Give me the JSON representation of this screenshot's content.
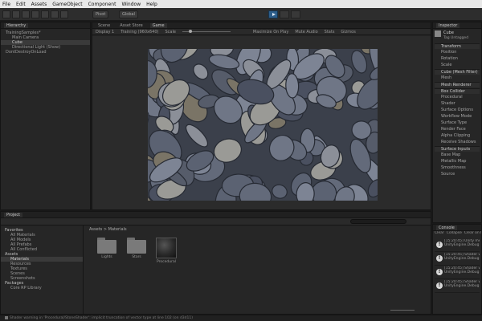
{
  "menu": [
    "File",
    "Edit",
    "Assets",
    "GameObject",
    "Component",
    "Window",
    "Help"
  ],
  "toolbar": {
    "pivot_label": "Pivot",
    "global_label": "Global"
  },
  "hierarchy": {
    "tab_label": "Hierarchy",
    "items": [
      {
        "label": "TrainingSamples*",
        "indent": 0,
        "selected": false
      },
      {
        "label": "Main Camera",
        "indent": 1,
        "selected": false
      },
      {
        "label": "Cube",
        "indent": 1,
        "selected": true
      },
      {
        "label": "Directional Light (Show)",
        "indent": 1,
        "selected": false
      },
      {
        "label": "DontDestroyOnLoad",
        "indent": 0,
        "selected": false
      }
    ]
  },
  "center": {
    "tabs": [
      "Scene",
      "Asset Store",
      "Game"
    ],
    "display_label": "Display 1",
    "aspect_label": "Training (960x640)",
    "scale_label": "Scale",
    "maximize_label": "Maximize On Play",
    "mute_label": "Mute Audio",
    "stats_label": "Stats",
    "gizmos_label": "Gizmos"
  },
  "inspector": {
    "tab_label": "Inspector",
    "object_name": "Cube",
    "tag_label": "Tag Untagged",
    "rows": [
      {
        "label": "Transform",
        "header": true
      },
      {
        "label": "Position",
        "header": false
      },
      {
        "label": "Rotation",
        "header": false
      },
      {
        "label": "Scale",
        "header": false
      },
      {
        "label": "Cube (Mesh Filter)",
        "header": true
      },
      {
        "label": "Mesh",
        "header": false
      },
      {
        "label": "Mesh Renderer",
        "header": true
      },
      {
        "label": "Box Collider",
        "header": true
      },
      {
        "label": "Procedural",
        "header": false
      },
      {
        "label": "Shader",
        "header": false
      },
      {
        "label": "Surface Options",
        "header": false
      },
      {
        "label": "Workflow Mode",
        "header": false
      },
      {
        "label": "Surface Type",
        "header": false
      },
      {
        "label": "Render Face",
        "header": false
      },
      {
        "label": "Alpha Clipping",
        "header": false
      },
      {
        "label": "Receive Shadows",
        "header": false
      },
      {
        "label": "Surface Inputs",
        "header": true
      },
      {
        "label": "Base Map",
        "header": false
      },
      {
        "label": "Metallic Map",
        "header": false
      },
      {
        "label": "Smoothness",
        "header": false
      },
      {
        "label": "Source",
        "header": false
      }
    ]
  },
  "project": {
    "tabs": [
      "Project",
      "Console"
    ],
    "tree": [
      {
        "label": "Favorites",
        "type": "header"
      },
      {
        "label": "All Materials",
        "type": "item"
      },
      {
        "label": "All Models",
        "type": "item"
      },
      {
        "label": "All Prefabs",
        "type": "item"
      },
      {
        "label": "All Conflicted",
        "type": "item"
      },
      {
        "label": "Assets",
        "type": "header"
      },
      {
        "label": "Materials",
        "type": "selected"
      },
      {
        "label": "Resources",
        "type": "item"
      },
      {
        "label": "Textures",
        "type": "item"
      },
      {
        "label": "Scenes",
        "type": "item"
      },
      {
        "label": "Screenshots",
        "type": "item"
      },
      {
        "label": "Packages",
        "type": "header"
      },
      {
        "label": "Core RP Library",
        "type": "item"
      }
    ],
    "breadcrumb": "Assets > Materials",
    "assets": [
      {
        "label": "Lights",
        "kind": "folder"
      },
      {
        "label": "Stars",
        "kind": "folder"
      },
      {
        "label": "Procedural",
        "kind": "material"
      }
    ]
  },
  "console": {
    "tab_label": "Console",
    "buttons": [
      "Clear",
      "Collapse",
      "Clear on Play",
      "Error Pause"
    ],
    "entries": [
      "[15:20:45] Unity message: Camera.main\nUnityEngine.Debug:Log",
      "[15:20:45] Shader warning in Procedural\nUnityEngine.Debug:LogWarning",
      "[15:20:45] Shader warning in Procedural\nUnityEngine.Debug:LogWarning",
      "[15:20:45] Shader warning in Procedural\nUnityEngine.Debug:LogWarning"
    ]
  },
  "status": {
    "text": "Shader warning in 'Procedural/StoneShader': implicit truncation of vector type at line 102 (on d3d11)"
  },
  "colors": {
    "play_button": "#2c5d8a",
    "background": "#191919",
    "panel": "#262626"
  }
}
